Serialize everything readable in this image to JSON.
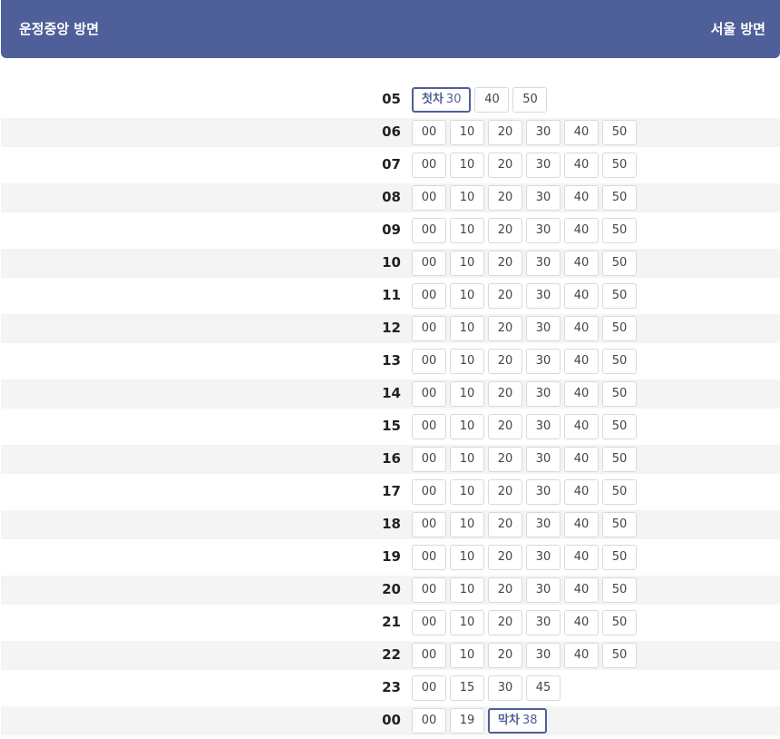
{
  "header": {
    "left_label": "운정중앙 방면",
    "right_label": "서울 방면"
  },
  "colors": {
    "accent": "#4f5f99",
    "row_shade": "#f4f4f4"
  },
  "schedule": [
    {
      "hour": "05",
      "minutes": [
        {
          "value": "30",
          "tag": "첫차"
        },
        {
          "value": "40"
        },
        {
          "value": "50"
        }
      ]
    },
    {
      "hour": "06",
      "minutes": [
        {
          "value": "00"
        },
        {
          "value": "10"
        },
        {
          "value": "20"
        },
        {
          "value": "30"
        },
        {
          "value": "40"
        },
        {
          "value": "50"
        }
      ]
    },
    {
      "hour": "07",
      "minutes": [
        {
          "value": "00"
        },
        {
          "value": "10"
        },
        {
          "value": "20"
        },
        {
          "value": "30"
        },
        {
          "value": "40"
        },
        {
          "value": "50"
        }
      ]
    },
    {
      "hour": "08",
      "minutes": [
        {
          "value": "00"
        },
        {
          "value": "10"
        },
        {
          "value": "20"
        },
        {
          "value": "30"
        },
        {
          "value": "40"
        },
        {
          "value": "50"
        }
      ]
    },
    {
      "hour": "09",
      "minutes": [
        {
          "value": "00"
        },
        {
          "value": "10"
        },
        {
          "value": "20"
        },
        {
          "value": "30"
        },
        {
          "value": "40"
        },
        {
          "value": "50"
        }
      ]
    },
    {
      "hour": "10",
      "minutes": [
        {
          "value": "00"
        },
        {
          "value": "10"
        },
        {
          "value": "20"
        },
        {
          "value": "30"
        },
        {
          "value": "40"
        },
        {
          "value": "50"
        }
      ]
    },
    {
      "hour": "11",
      "minutes": [
        {
          "value": "00"
        },
        {
          "value": "10"
        },
        {
          "value": "20"
        },
        {
          "value": "30"
        },
        {
          "value": "40"
        },
        {
          "value": "50"
        }
      ]
    },
    {
      "hour": "12",
      "minutes": [
        {
          "value": "00"
        },
        {
          "value": "10"
        },
        {
          "value": "20"
        },
        {
          "value": "30"
        },
        {
          "value": "40"
        },
        {
          "value": "50"
        }
      ]
    },
    {
      "hour": "13",
      "minutes": [
        {
          "value": "00"
        },
        {
          "value": "10"
        },
        {
          "value": "20"
        },
        {
          "value": "30"
        },
        {
          "value": "40"
        },
        {
          "value": "50"
        }
      ]
    },
    {
      "hour": "14",
      "minutes": [
        {
          "value": "00"
        },
        {
          "value": "10"
        },
        {
          "value": "20"
        },
        {
          "value": "30"
        },
        {
          "value": "40"
        },
        {
          "value": "50"
        }
      ]
    },
    {
      "hour": "15",
      "minutes": [
        {
          "value": "00"
        },
        {
          "value": "10"
        },
        {
          "value": "20"
        },
        {
          "value": "30"
        },
        {
          "value": "40"
        },
        {
          "value": "50"
        }
      ]
    },
    {
      "hour": "16",
      "minutes": [
        {
          "value": "00"
        },
        {
          "value": "10"
        },
        {
          "value": "20"
        },
        {
          "value": "30"
        },
        {
          "value": "40"
        },
        {
          "value": "50"
        }
      ]
    },
    {
      "hour": "17",
      "minutes": [
        {
          "value": "00"
        },
        {
          "value": "10"
        },
        {
          "value": "20"
        },
        {
          "value": "30"
        },
        {
          "value": "40"
        },
        {
          "value": "50"
        }
      ]
    },
    {
      "hour": "18",
      "minutes": [
        {
          "value": "00"
        },
        {
          "value": "10"
        },
        {
          "value": "20"
        },
        {
          "value": "30"
        },
        {
          "value": "40"
        },
        {
          "value": "50"
        }
      ]
    },
    {
      "hour": "19",
      "minutes": [
        {
          "value": "00"
        },
        {
          "value": "10"
        },
        {
          "value": "20"
        },
        {
          "value": "30"
        },
        {
          "value": "40"
        },
        {
          "value": "50"
        }
      ]
    },
    {
      "hour": "20",
      "minutes": [
        {
          "value": "00"
        },
        {
          "value": "10"
        },
        {
          "value": "20"
        },
        {
          "value": "30"
        },
        {
          "value": "40"
        },
        {
          "value": "50"
        }
      ]
    },
    {
      "hour": "21",
      "minutes": [
        {
          "value": "00"
        },
        {
          "value": "10"
        },
        {
          "value": "20"
        },
        {
          "value": "30"
        },
        {
          "value": "40"
        },
        {
          "value": "50"
        }
      ]
    },
    {
      "hour": "22",
      "minutes": [
        {
          "value": "00"
        },
        {
          "value": "10"
        },
        {
          "value": "20"
        },
        {
          "value": "30"
        },
        {
          "value": "40"
        },
        {
          "value": "50"
        }
      ]
    },
    {
      "hour": "23",
      "minutes": [
        {
          "value": "00"
        },
        {
          "value": "15"
        },
        {
          "value": "30"
        },
        {
          "value": "45"
        }
      ]
    },
    {
      "hour": "00",
      "minutes": [
        {
          "value": "00"
        },
        {
          "value": "19"
        },
        {
          "value": "38",
          "tag": "막차"
        }
      ]
    }
  ]
}
